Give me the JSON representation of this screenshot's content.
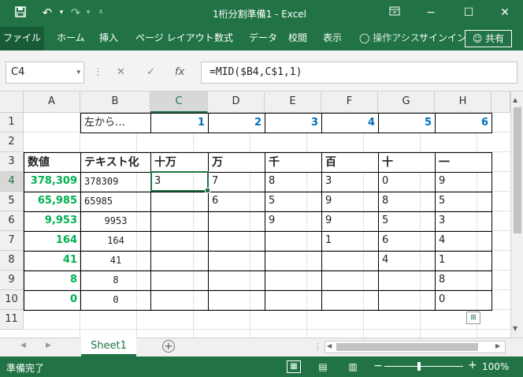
{
  "title_bar": {
    "title": "1桁分割準備1 - Excel",
    "save_icon": "save-icon",
    "undo_icon": "undo-icon",
    "redo_icon": "redo-icon",
    "customize_icon": "chevron-down-icon",
    "ribbon_options_icon": "ribbon-display-icon",
    "minimize": "−",
    "maximize": "☐",
    "close": "✕"
  },
  "ribbon": {
    "tabs": [
      "ファイル",
      "ホーム",
      "挿入",
      "ページ レイアウト",
      "数式",
      "データ",
      "校閲",
      "表示"
    ],
    "tell_me": "操作アシス",
    "signin": "サインイン",
    "share": "共有"
  },
  "formula_bar": {
    "name_box": "C4",
    "cancel": "✕",
    "enter": "✓",
    "fx": "fx",
    "formula": "=MID($B4,C$1,1)"
  },
  "columns": [
    "A",
    "B",
    "C",
    "D",
    "E",
    "F",
    "G",
    "H"
  ],
  "rows": [
    "1",
    "2",
    "3",
    "4",
    "5",
    "6",
    "7",
    "8",
    "9",
    "10",
    "11"
  ],
  "cells": {
    "B1": "左から…",
    "C1": "1",
    "D1": "2",
    "E1": "3",
    "F1": "4",
    "G1": "5",
    "H1": "6",
    "A3": "数値",
    "B3": "テキスト化",
    "C3": "十万",
    "D3": "万",
    "E3": "千",
    "F3": "百",
    "G3": "十",
    "H3": "一",
    "A4": "378,309",
    "B4": "378309",
    "C4": "3",
    "D4": "7",
    "E4": "8",
    "F4": "3",
    "G4": "0",
    "H4": "9",
    "A5": "65,985",
    "B5": "65985",
    "D5": "6",
    "E5": "5",
    "F5": "9",
    "G5": "8",
    "H5": "5",
    "A6": "9,953",
    "B6": "9953",
    "E6": "9",
    "F6": "9",
    "G6": "5",
    "H6": "3",
    "A7": "164",
    "B7": "164",
    "F7": "1",
    "G7": "6",
    "H7": "4",
    "A8": "41",
    "B8": "41",
    "G8": "4",
    "H8": "1",
    "A9": "8",
    "B9": "8",
    "H9": "8",
    "A10": "0",
    "B10": "0",
    "H10": "0"
  },
  "sheet_tabs": [
    "Sheet1"
  ],
  "status_bar": {
    "ready": "準備完了",
    "zoom": "100%"
  }
}
